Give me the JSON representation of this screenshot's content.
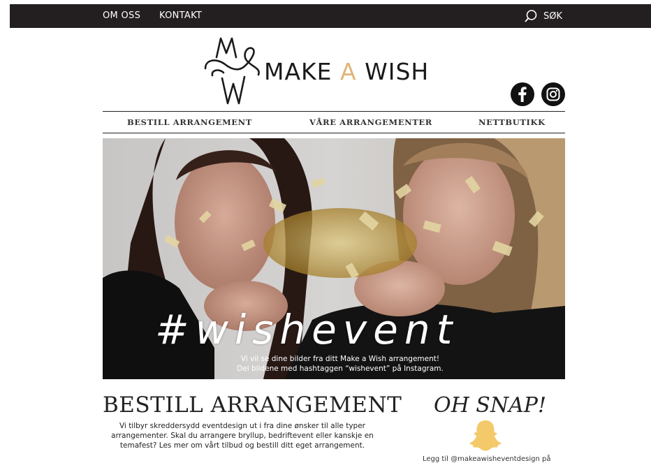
{
  "topbar": {
    "links": [
      "OM OSS",
      "KONTAKT"
    ],
    "search_label": "SØK"
  },
  "logo": {
    "word_make": "MAKE",
    "word_a": "A",
    "word_wish": "WISH",
    "accent_color": "#e0b578"
  },
  "social": [
    "facebook-icon",
    "instagram-icon"
  ],
  "main_nav": [
    "BESTILL ARRANGEMENT",
    "VÅRE ARRANGEMENTER",
    "NETTBUTIKK"
  ],
  "hero": {
    "hashtag": "#wishevent",
    "line1": "Vi vil se dine bilder fra ditt Make a Wish arrangement!",
    "line2": "Del bildene med hashtaggen “wishevent” på Instagram."
  },
  "bestill": {
    "heading": "BESTILL ARRANGEMENT",
    "text": "Vi tilbyr skreddersydd eventdesign ut i fra dine ønsker til alle typer arrangementer. Skal du arrangere bryllup, bedriftevent eller kanskje en temafest? Les mer om vårt tilbud og bestill ditt eget arrangement."
  },
  "snap": {
    "heading": "OH SNAP!",
    "text": "Legg til @makeawisheventdesign på"
  }
}
